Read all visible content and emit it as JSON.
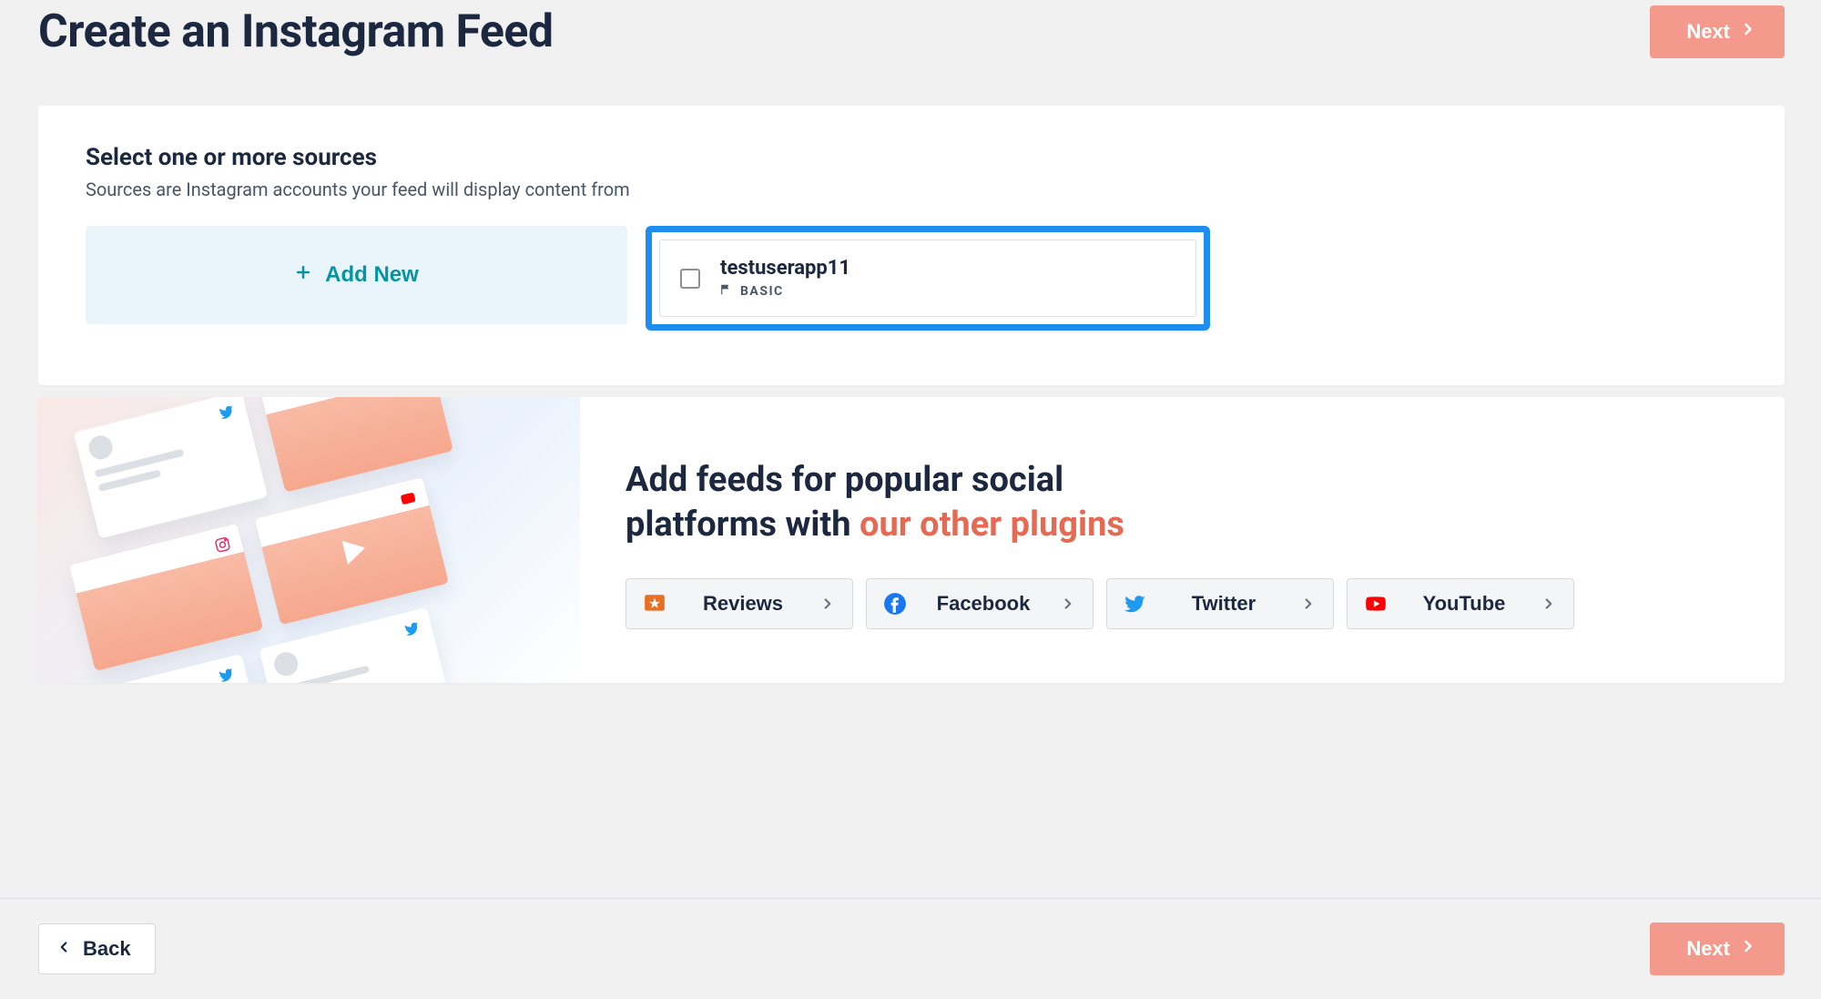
{
  "header": {
    "title": "Create an Instagram Feed",
    "next_label": "Next"
  },
  "sources": {
    "title": "Select one or more sources",
    "subtitle": "Sources are Instagram accounts your feed will display content from",
    "add_new_label": "Add New",
    "items": [
      {
        "name": "testuserapp11",
        "tier": "BASIC"
      }
    ]
  },
  "promo": {
    "title_before": "Add feeds for popular social platforms with ",
    "title_accent": "our other plugins",
    "plugins": [
      {
        "label": "Reviews"
      },
      {
        "label": "Facebook"
      },
      {
        "label": "Twitter"
      },
      {
        "label": "YouTube"
      }
    ]
  },
  "footer": {
    "back_label": "Back",
    "next_label": "Next"
  }
}
